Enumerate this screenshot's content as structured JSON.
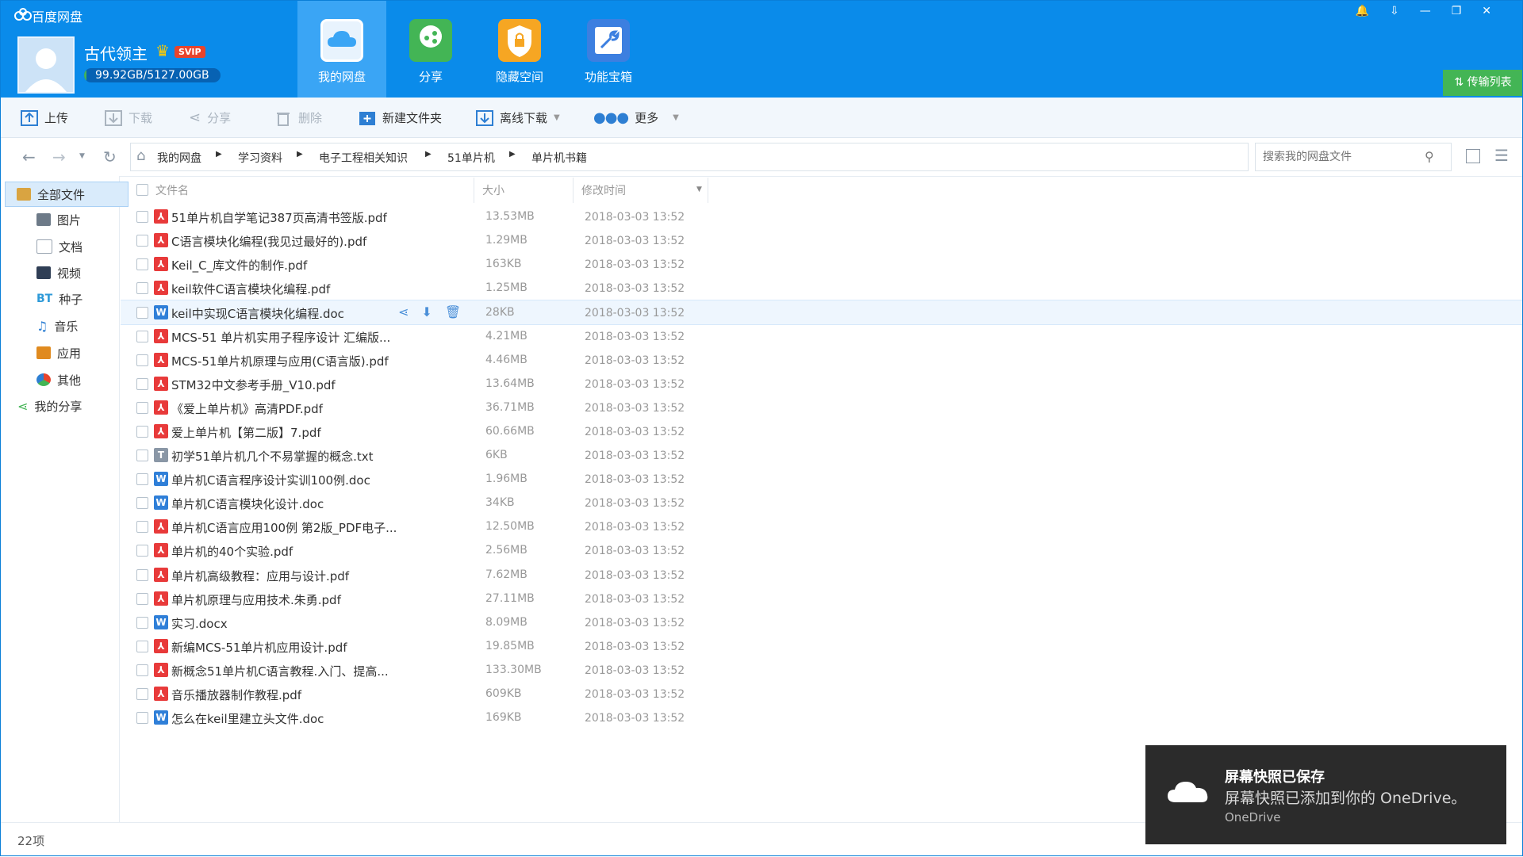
{
  "app": {
    "title": "百度网盘",
    "username": "古代领主",
    "badge": "SVIP",
    "quota_text": "99.92GB/5127.00GB",
    "quota_fraction": 0.0195
  },
  "nav_tabs": [
    {
      "label": "我的网盘",
      "icon": "my-disk-icon",
      "active": true
    },
    {
      "label": "分享",
      "icon": "share-icon",
      "active": false
    },
    {
      "label": "隐藏空间",
      "icon": "lock-icon",
      "active": false
    },
    {
      "label": "功能宝箱",
      "icon": "toolbox-icon",
      "active": false
    }
  ],
  "transfer_label": "传输列表",
  "toolbar": {
    "upload": "上传",
    "download": "下载",
    "share": "分享",
    "delete": "删除",
    "new_folder": "新建文件夹",
    "offline_download": "离线下载",
    "more": "更多"
  },
  "breadcrumb": [
    "我的网盘",
    "学习资料",
    "电子工程相关知识",
    "51单片机",
    "单片机书籍"
  ],
  "search": {
    "placeholder": "搜索我的网盘文件"
  },
  "sidebar": {
    "items": [
      {
        "label": "全部文件",
        "icon": "folder-icon"
      },
      {
        "label": "图片",
        "icon": "image-icon"
      },
      {
        "label": "文档",
        "icon": "document-icon"
      },
      {
        "label": "视频",
        "icon": "video-icon"
      },
      {
        "label": "种子",
        "icon": "bt-icon"
      },
      {
        "label": "音乐",
        "icon": "music-icon"
      },
      {
        "label": "应用",
        "icon": "app-icon"
      },
      {
        "label": "其他",
        "icon": "other-icon"
      },
      {
        "label": "我的分享",
        "icon": "share-icon"
      }
    ]
  },
  "columns": {
    "name": "文件名",
    "size": "大小",
    "modified": "修改时间"
  },
  "files": [
    {
      "name": "51单片机自学笔记387页高清书签版.pdf",
      "type": "pdf",
      "size": "13.53MB",
      "date": "2018-03-03 13:52"
    },
    {
      "name": "C语言模块化编程(我见过最好的).pdf",
      "type": "pdf",
      "size": "1.29MB",
      "date": "2018-03-03 13:52"
    },
    {
      "name": "Keil_C_库文件的制作.pdf",
      "type": "pdf",
      "size": "163KB",
      "date": "2018-03-03 13:52"
    },
    {
      "name": "keil软件C语言模块化编程.pdf",
      "type": "pdf",
      "size": "1.25MB",
      "date": "2018-03-03 13:52"
    },
    {
      "name": "keil中实现C语言模块化编程.doc",
      "type": "doc",
      "size": "28KB",
      "date": "2018-03-03 13:52"
    },
    {
      "name": "MCS-51 单片机实用子程序设计 汇编版...",
      "type": "pdf",
      "size": "4.21MB",
      "date": "2018-03-03 13:52"
    },
    {
      "name": "MCS-51单片机原理与应用(C语言版).pdf",
      "type": "pdf",
      "size": "4.46MB",
      "date": "2018-03-03 13:52"
    },
    {
      "name": "STM32中文参考手册_V10.pdf",
      "type": "pdf",
      "size": "13.64MB",
      "date": "2018-03-03 13:52"
    },
    {
      "name": "《爱上单片机》高清PDF.pdf",
      "type": "pdf",
      "size": "36.71MB",
      "date": "2018-03-03 13:52"
    },
    {
      "name": "爱上单片机【第二版】7.pdf",
      "type": "pdf",
      "size": "60.66MB",
      "date": "2018-03-03 13:52"
    },
    {
      "name": "初学51单片机几个不易掌握的概念.txt",
      "type": "txt",
      "size": "6KB",
      "date": "2018-03-03 13:52"
    },
    {
      "name": "单片机C语言程序设计实训100例.doc",
      "type": "doc",
      "size": "1.96MB",
      "date": "2018-03-03 13:52"
    },
    {
      "name": "单片机C语言模块化设计.doc",
      "type": "doc",
      "size": "34KB",
      "date": "2018-03-03 13:52"
    },
    {
      "name": "单片机C语言应用100例 第2版_PDF电子...",
      "type": "pdf",
      "size": "12.50MB",
      "date": "2018-03-03 13:52"
    },
    {
      "name": "单片机的40个实验.pdf",
      "type": "pdf",
      "size": "2.56MB",
      "date": "2018-03-03 13:52"
    },
    {
      "name": "单片机高级教程：应用与设计.pdf",
      "type": "pdf",
      "size": "7.62MB",
      "date": "2018-03-03 13:52"
    },
    {
      "name": "单片机原理与应用技术.朱勇.pdf",
      "type": "pdf",
      "size": "27.11MB",
      "date": "2018-03-03 13:52"
    },
    {
      "name": "实习.docx",
      "type": "doc",
      "size": "8.09MB",
      "date": "2018-03-03 13:52"
    },
    {
      "name": "新编MCS-51单片机应用设计.pdf",
      "type": "pdf",
      "size": "19.85MB",
      "date": "2018-03-03 13:52"
    },
    {
      "name": "新概念51单片机C语言教程.入门、提高...",
      "type": "pdf",
      "size": "133.30MB",
      "date": "2018-03-03 13:52"
    },
    {
      "name": "音乐播放器制作教程.pdf",
      "type": "pdf",
      "size": "609KB",
      "date": "2018-03-03 13:52"
    },
    {
      "name": "怎么在keil里建立头文件.doc",
      "type": "doc",
      "size": "169KB",
      "date": "2018-03-03 13:52"
    }
  ],
  "highlighted_row": 4,
  "status": {
    "count": "22项"
  },
  "toast": {
    "title": "屏幕快照已保存",
    "body": "屏幕快照已添加到你的 OneDrive。",
    "app": "OneDrive"
  },
  "colors": {
    "header": "#0a8bea",
    "pdf": "#e83a3a",
    "doc": "#2f7fd8",
    "accent_green": "#43b555"
  }
}
